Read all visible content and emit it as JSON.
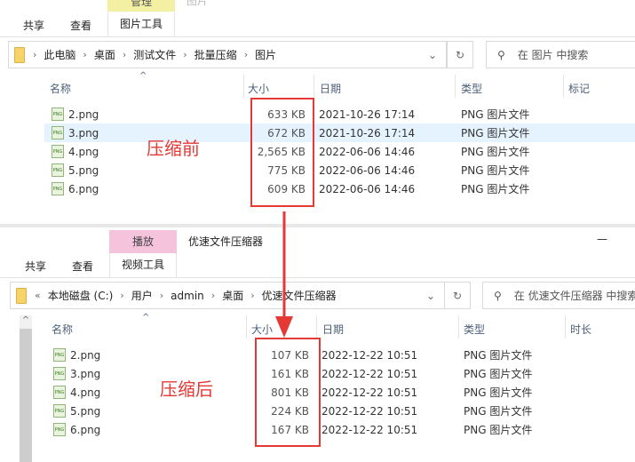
{
  "top_window": {
    "context_tab": "管理",
    "title": "图片",
    "ribbon_tabs": [
      "共享",
      "查看",
      "图片工具"
    ],
    "breadcrumb": [
      "此电脑",
      "桌面",
      "测试文件",
      "批量压缩",
      "图片"
    ],
    "search_placeholder": "在 图片 中搜索",
    "columns": [
      "名称",
      "大小",
      "日期",
      "类型",
      "标记"
    ],
    "files": [
      {
        "name": "2.png",
        "size": "633 KB",
        "date": "2021-10-26 17:14",
        "type": "PNG 图片文件"
      },
      {
        "name": "3.png",
        "size": "672 KB",
        "date": "2021-10-26 17:14",
        "type": "PNG 图片文件"
      },
      {
        "name": "4.png",
        "size": "2,565 KB",
        "date": "2022-06-06 14:46",
        "type": "PNG 图片文件"
      },
      {
        "name": "5.png",
        "size": "775 KB",
        "date": "2022-06-06 14:46",
        "type": "PNG 图片文件"
      },
      {
        "name": "6.png",
        "size": "609 KB",
        "date": "2022-06-06 14:46",
        "type": "PNG 图片文件"
      }
    ],
    "annotation": "压缩前"
  },
  "bottom_window": {
    "context_tab": "播放",
    "title": "优速文件压缩器",
    "ribbon_tabs": [
      "共享",
      "查看",
      "视频工具"
    ],
    "breadcrumb": [
      "本地磁盘 (C:)",
      "用户",
      "admin",
      "桌面",
      "优速文件压缩器"
    ],
    "search_placeholder": "在 优速文件压缩器 中搜索",
    "columns": [
      "名称",
      "大小",
      "日期",
      "类型",
      "时长"
    ],
    "files": [
      {
        "name": "2.png",
        "size": "107 KB",
        "date": "2022-12-22 10:51",
        "type": "PNG 图片文件"
      },
      {
        "name": "3.png",
        "size": "161 KB",
        "date": "2022-12-22 10:51",
        "type": "PNG 图片文件"
      },
      {
        "name": "4.png",
        "size": "801 KB",
        "date": "2022-12-22 10:51",
        "type": "PNG 图片文件"
      },
      {
        "name": "5.png",
        "size": "224 KB",
        "date": "2022-12-22 10:51",
        "type": "PNG 图片文件"
      },
      {
        "name": "6.png",
        "size": "167 KB",
        "date": "2022-12-22 10:51",
        "type": "PNG 图片文件"
      }
    ],
    "annotation": "压缩后"
  },
  "colors": {
    "accent_red": "#e53935",
    "manage_tab": "#f3f0a4",
    "play_tab": "#f6c3dd",
    "selected_row": "#e5f3ff"
  }
}
